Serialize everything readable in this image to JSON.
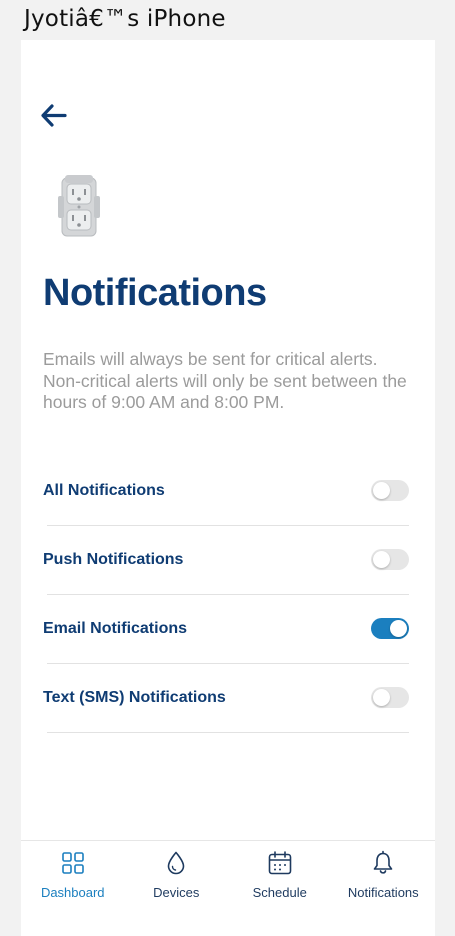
{
  "window": {
    "title": "Jyotiâ€™s iPhone"
  },
  "header": {
    "back_icon": "arrow-left-icon"
  },
  "page": {
    "title": "Notifications",
    "description": "Emails will always be sent for critical alerts. Non-critical alerts will only be sent between the hours of 9:00 AM and 8:00 PM."
  },
  "settings": [
    {
      "label": "All Notifications",
      "enabled": false
    },
    {
      "label": "Push Notifications",
      "enabled": false
    },
    {
      "label": "Email Notifications",
      "enabled": true
    },
    {
      "label": "Text (SMS) Notifications",
      "enabled": false
    }
  ],
  "tabs": [
    {
      "label": "Dashboard",
      "icon": "grid-icon",
      "active": true
    },
    {
      "label": "Devices",
      "icon": "water-drop-icon",
      "active": false
    },
    {
      "label": "Schedule",
      "icon": "calendar-icon",
      "active": false
    },
    {
      "label": "Notifications",
      "icon": "bell-icon",
      "active": false
    }
  ],
  "colors": {
    "brand_navy": "#0f3c73",
    "accent_blue": "#1b7fbf",
    "muted_text": "#9b9b9b",
    "toggle_off": "#e6e6e6"
  }
}
